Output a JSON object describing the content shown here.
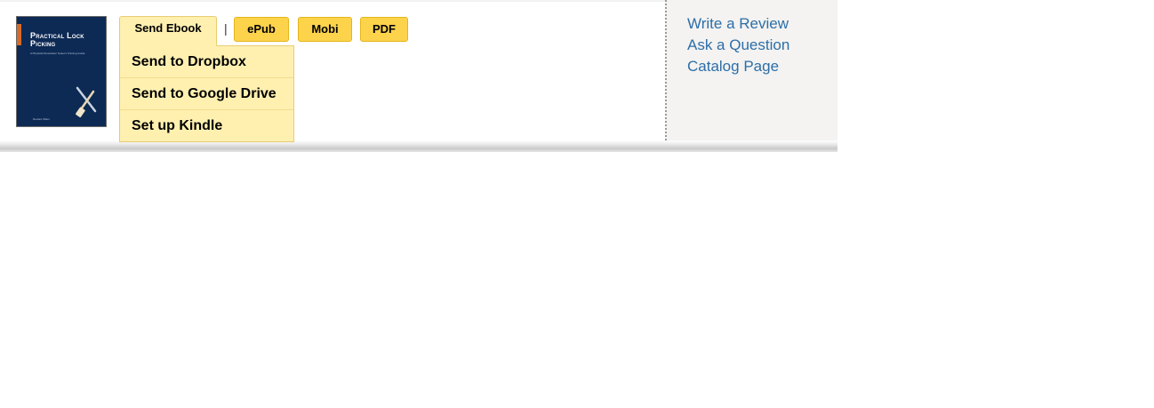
{
  "book": {
    "cover_title": "Practical Lock Picking",
    "cover_subtitle": "A Physical Penetration Tester's Training Guide",
    "cover_author": "Deviant Ollam"
  },
  "toolbar": {
    "send_ebook_label": "Send Ebook",
    "separator": "|",
    "formats": [
      "ePub",
      "Mobi",
      "PDF"
    ]
  },
  "dropdown": {
    "items": [
      "Send to Dropbox",
      "Send to Google Drive",
      "Set up Kindle"
    ]
  },
  "sidebar": {
    "links": [
      "Write a Review",
      "Ask a Question",
      "Catalog Page"
    ]
  },
  "colors": {
    "button": "#fdd34c",
    "button_active": "#fff0b0",
    "link": "#2d6ea8",
    "cover": "#0d2a55"
  }
}
